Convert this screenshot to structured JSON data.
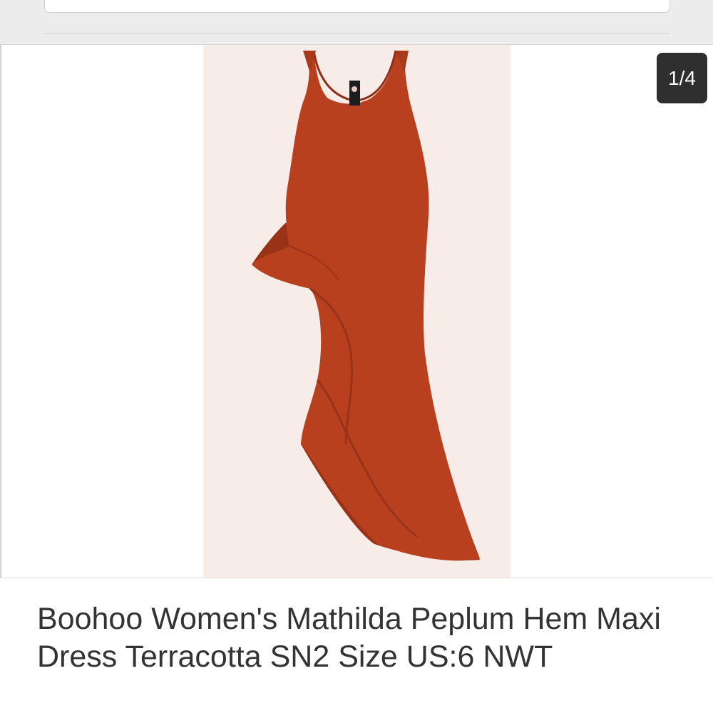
{
  "gallery": {
    "counter": "1/4",
    "current_index": 1,
    "total": 4,
    "image_icon": "dress-photo"
  },
  "product": {
    "title": "Boohoo Women's Mathilda Peplum Hem Maxi Dress Terracotta SN2 Size US:6 NWT"
  },
  "colors": {
    "dress": "#b8401f",
    "image_background": "#f8ece9",
    "badge": "#2f2f2f",
    "title_text": "#333333"
  }
}
